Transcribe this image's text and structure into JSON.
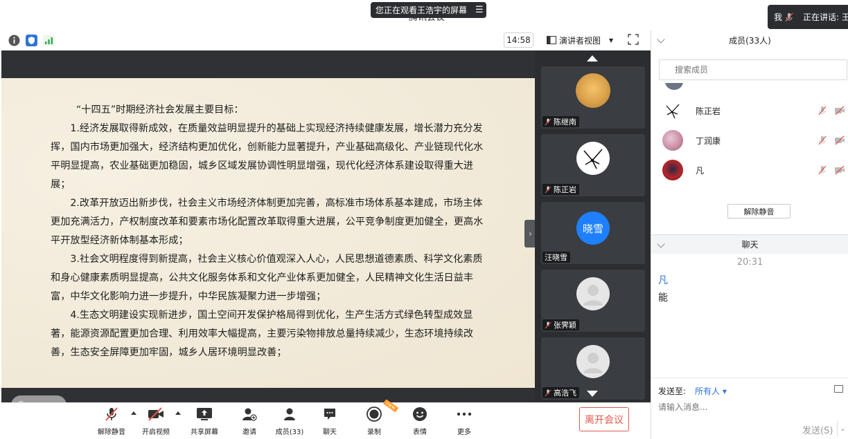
{
  "window": {
    "title": "腾讯会议"
  },
  "viewing_banner": {
    "text": "您正在观看王浩宇的屏幕"
  },
  "top_right": {
    "me_label": "我",
    "speaking_label": "正在讲话: 王"
  },
  "info_bar": {
    "timer": "14:58",
    "view_mode": "演讲者视图"
  },
  "slide": {
    "heading": "“十四五”时期经济社会发展主要目标：",
    "paragraphs": [
      "1.经济发展取得新成效，在质量效益明显提升的基础上实现经济持续健康发展，增长潜力充分发挥，国内市场更加强大，经济结构更加优化，创新能力显著提升，产业基础高级化、产业链现代化水平明显提高，农业基础更加稳固，城乡区域发展协调性明显增强，现代化经济体系建设取得重大进展；",
      "2.改革开放迈出新步伐，社会主义市场经济体制更加完善，高标准市场体系基本建成，市场主体更加充满活力，产权制度改革和要素市场化配置改革取得重大进展，公平竞争制度更加健全，更高水平开放型经济新体制基本形成；",
      "3.社会文明程度得到新提高，社会主义核心价值观深入人心，人民思想道德素质、科学文化素质和身心健康素质明显提高，公共文化服务体系和文化产业体系更加健全，人民精神文化生活日益丰富，中华文化影响力进一步提升，中华民族凝聚力进一步增强；",
      "4.生态文明建设实现新进步，国土空间开发保护格局得到优化，生产生活方式绿色转型成效显著，能源资源配置更加合理、利用效率大幅提高，主要污染物排放总量持续减少，生态环境持续改善，生态安全屏障更加牢固，城乡人居环境明显改善；"
    ]
  },
  "gallery": {
    "tiles": [
      {
        "name": "陈继南",
        "muted": true,
        "avatar_color": "#d9a04a"
      },
      {
        "name": "陈正岩",
        "muted": true,
        "avatar_color": "#ffffff"
      },
      {
        "name": "汪晓雪",
        "muted": false,
        "avatar_text": "晓雪",
        "avatar_color": "#1e80ff"
      },
      {
        "name": "张霁颖",
        "muted": true,
        "avatar_color": "#e6e6e6"
      },
      {
        "name": "高浩飞",
        "muted": true,
        "avatar_color": "#e6e6e6"
      }
    ]
  },
  "toolbar": {
    "unmute": "解除静音",
    "video": "开启视频",
    "share": "共享屏幕",
    "invite": "邀请",
    "members": "成员(33)",
    "chat": "聊天",
    "record": "录制",
    "reactions": "表情",
    "more": "更多",
    "leave": "离开会议",
    "new_badge": "new"
  },
  "members_panel": {
    "title": "成员(33人)",
    "search_placeholder": "搜索成员",
    "members": [
      {
        "name": "陈正岩",
        "avatar_color": "#ffffff"
      },
      {
        "name": "丁润康",
        "avatar_color": "#c98aa4"
      },
      {
        "name": "凡",
        "avatar_color": "#b3262b"
      }
    ],
    "unmute_all": "解除静音"
  },
  "chat_panel": {
    "title": "聊天",
    "time": "20:31",
    "sender": "凡",
    "message": "能",
    "send_to_label": "发送至:",
    "send_to_value": "所有人 ▾",
    "input_placeholder": "请输入消息...",
    "send_label": "发送(S)"
  },
  "colors": {
    "accent": "#2d73d8",
    "danger": "#e5574b",
    "gallery_bg": "#2b2d31"
  }
}
